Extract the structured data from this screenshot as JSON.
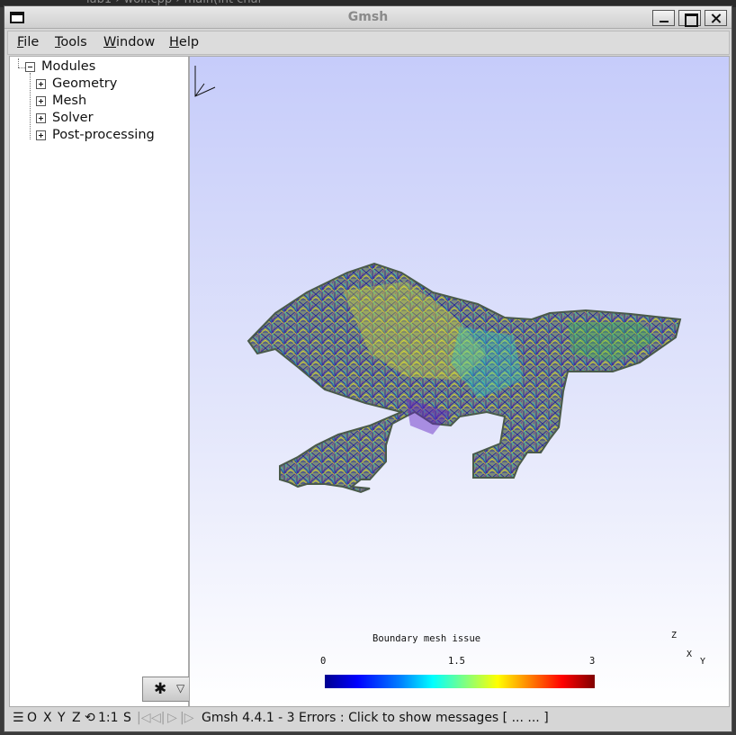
{
  "window": {
    "title": "Gmsh"
  },
  "menu": {
    "items": [
      "File",
      "Tools",
      "Window",
      "Help"
    ]
  },
  "tree": {
    "root": "Modules",
    "children": [
      "Geometry",
      "Mesh",
      "Solver",
      "Post-processing"
    ]
  },
  "viewport": {
    "legend_title": "Boundary mesh issue",
    "ticks": [
      "0",
      "1.5",
      "3"
    ],
    "axes": {
      "z": "Z",
      "x": "X",
      "y": "Y"
    }
  },
  "statusbar": {
    "buttons": [
      "☰",
      "O",
      "X",
      "Y",
      "Z",
      "⟲",
      "1:1",
      "S"
    ],
    "anim_buttons": [
      "|◁",
      "◁|",
      "▷",
      "|▷"
    ],
    "message": "Gmsh 4.4.1  -  3 Errors : Click to show messages [ ...  ... ]"
  },
  "colors": {
    "viewport_top": "#c6ccfa",
    "viewport_bottom": "#ffffff"
  }
}
